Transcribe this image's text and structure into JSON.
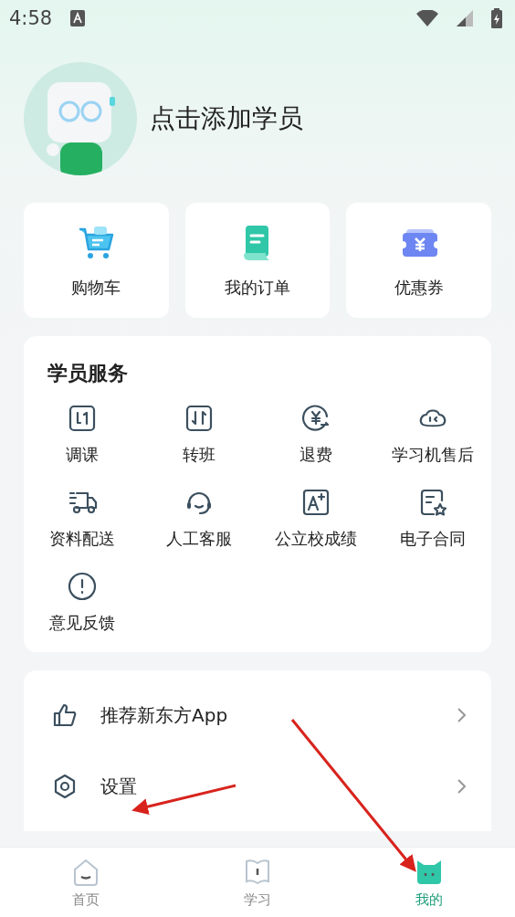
{
  "status_bar": {
    "time": "4:58"
  },
  "profile": {
    "name": "点击添加学员"
  },
  "quick_links": [
    {
      "label": "购物车"
    },
    {
      "label": "我的订单"
    },
    {
      "label": "优惠券"
    }
  ],
  "services": {
    "title": "学员服务",
    "items": [
      {
        "label": "调课"
      },
      {
        "label": "转班"
      },
      {
        "label": "退费"
      },
      {
        "label": "学习机售后"
      },
      {
        "label": "资料配送"
      },
      {
        "label": "人工客服"
      },
      {
        "label": "公立校成绩"
      },
      {
        "label": "电子合同"
      },
      {
        "label": "意见反馈"
      }
    ]
  },
  "menu": [
    {
      "label": "推荐新东方App"
    },
    {
      "label": "设置"
    }
  ],
  "tab_bar": [
    {
      "label": "首页",
      "selected": false
    },
    {
      "label": "学习",
      "selected": false
    },
    {
      "label": "我的",
      "selected": true
    }
  ]
}
